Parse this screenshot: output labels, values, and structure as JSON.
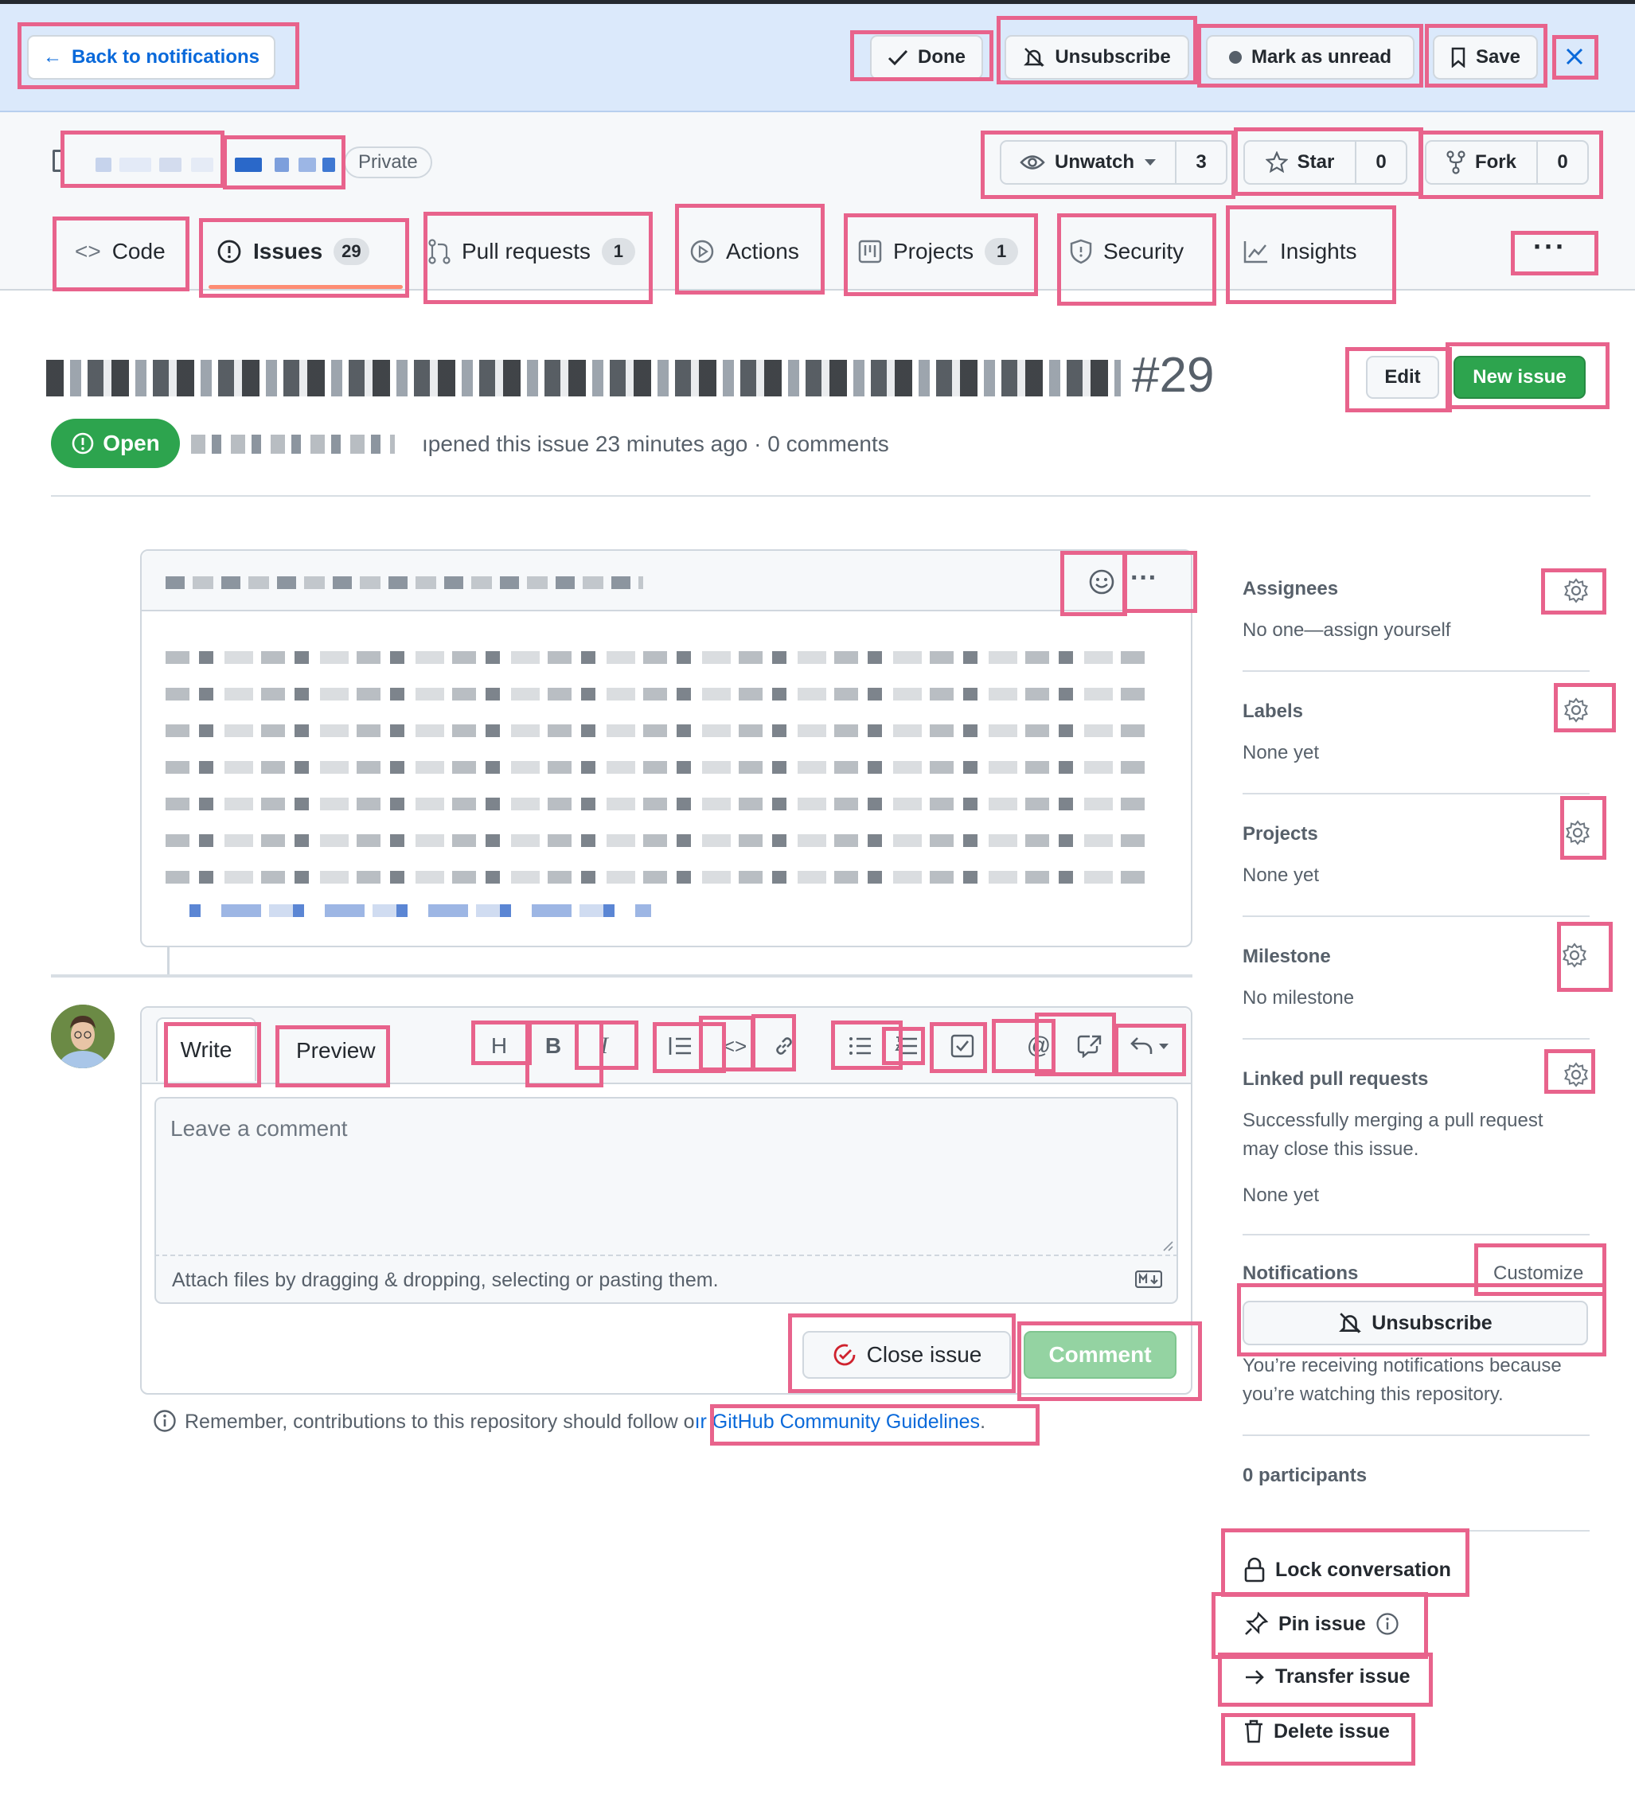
{
  "notifications_bar": {
    "back_label": "Back to notifications",
    "done_label": "Done",
    "unsubscribe_label": "Unsubscribe",
    "mark_unread_label": "Mark as unread",
    "save_label": "Save"
  },
  "repo": {
    "visibility_label": "Private",
    "unwatch_label": "Unwatch",
    "watch_count": "3",
    "star_label": "Star",
    "star_count": "0",
    "fork_label": "Fork",
    "fork_count": "0"
  },
  "tabs": [
    {
      "label": "Code"
    },
    {
      "label": "Issues",
      "count": "29"
    },
    {
      "label": "Pull requests",
      "count": "1"
    },
    {
      "label": "Actions"
    },
    {
      "label": "Projects",
      "count": "1"
    },
    {
      "label": "Security"
    },
    {
      "label": "Insights"
    }
  ],
  "issue": {
    "number": "#29",
    "edit_label": "Edit",
    "new_issue_label": "New issue",
    "state_label": "Open",
    "meta_text": "ıpened this issue 23 minutes ago · 0 comments"
  },
  "composer": {
    "write_tab": "Write",
    "preview_tab": "Preview",
    "placeholder": "Leave a comment",
    "attach_hint": "Attach files by dragging & dropping, selecting or pasting them.",
    "close_issue_label": "Close issue",
    "comment_label": "Comment",
    "guidelines_prefix": "Remember, contributions to this repository should follow o",
    "guidelines_link": "ır GitHub Community Guidelines",
    "guidelines_suffix": "."
  },
  "sidebar": {
    "assignees_title": "Assignees",
    "assignees_value": "No one—assign yourself",
    "labels_title": "Labels",
    "labels_value": "None yet",
    "projects_title": "Projects",
    "projects_value": "None yet",
    "milestone_title": "Milestone",
    "milestone_value": "No milestone",
    "linked_title": "Linked pull requests",
    "linked_desc_line1": "Successfully merging a pull request",
    "linked_desc_line2": "may close this issue.",
    "linked_value": "None yet",
    "notifications_title": "Notifications",
    "customize_label": "Customize",
    "unsubscribe_label": "Unsubscribe",
    "notif_reason_line1": "You’re receiving notifications because",
    "notif_reason_line2": "you’re watching this repository.",
    "participants": "0 participants",
    "lock_label": "Lock conversation",
    "pin_label": "Pin issue",
    "transfer_label": "Transfer issue",
    "delete_label": "Delete issue"
  },
  "colors": {
    "accent_blue": "#0969da",
    "open_green": "#2da44e",
    "comment_green_disabled": "#94d3a2",
    "highlight_pink": "#e8638c"
  }
}
